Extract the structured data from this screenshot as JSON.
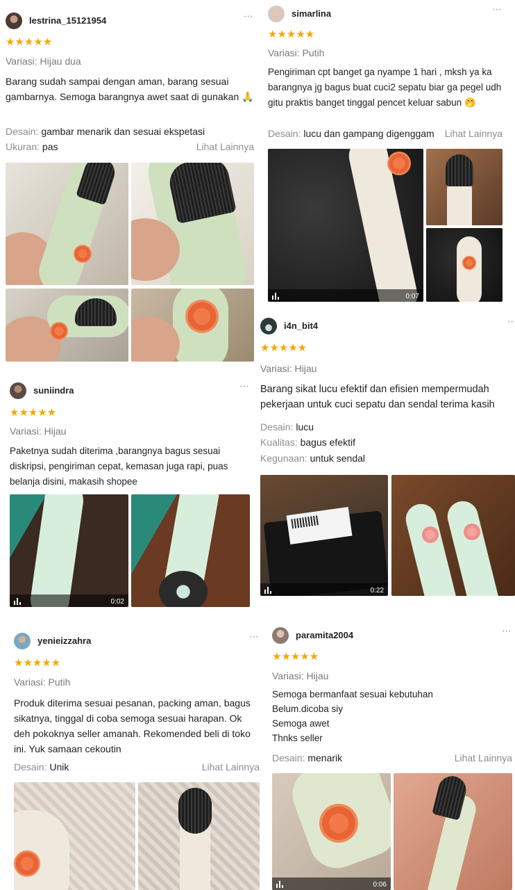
{
  "reviews": {
    "r1": {
      "username": "lestrina_15121954",
      "stars": "★★★★★",
      "variant": "Variasi: Hijau dua",
      "body": "Barang sudah sampai dengan aman, barang sesuai gambarnya. Semoga barangnya awet saat di gunakan 🙏",
      "attr1_key": "Desain:",
      "attr1_val": "gambar menarik dan sesuai ekspetasi",
      "attr2_key": "Ukuran:",
      "attr2_val": "pas",
      "see_more": "Lihat Lainnya"
    },
    "r2": {
      "username": "simarlina",
      "stars": "★★★★★",
      "variant": "Variasi: Putih",
      "body": "Pengiriman cpt banget ga nyampe 1 hari , mksh ya ka barangnya jg bagus buat cuci2 sepatu biar ga pegel udh gitu praktis banget tinggal pencet keluar sabun 🤭",
      "attr1_key": "Desain:",
      "attr1_val": "lucu dan gampang digenggam",
      "see_more": "Lihat Lainnya",
      "video_time": "0:07"
    },
    "r3": {
      "username": "i4n_bit4",
      "stars": "★★★★★",
      "variant": "Variasi: Hijau",
      "body": "Barang sikat lucu efektif dan efisien mempermudah pekerjaan untuk cuci sepatu dan sendal terima kasih",
      "attr1_key": "Desain:",
      "attr1_val": "lucu",
      "attr2_key": "Kualitas:",
      "attr2_val": "bagus efektif",
      "attr3_key": "Kegunaan:",
      "attr3_val": "untuk sendal",
      "video_time": "0:22"
    },
    "r4": {
      "username": "suniindra",
      "stars": "★★★★★",
      "variant": "Variasi: Hijau",
      "body": "Paketnya sudah diterima ,barangnya bagus sesuai diskripsi, pengiriman cepat, kemasan juga rapi, puas belanja disini, makasih shopee",
      "video_time": "0:02"
    },
    "r5": {
      "username": "yenieizzahra",
      "stars": "★★★★★",
      "variant": "Variasi: Putih",
      "body": "Produk diterima sesuai pesanan, packing aman, bagus sikatnya, tinggal di coba semoga sesuai harapan. Ok deh pokoknya seller amanah. Rekomended beli di toko ini. Yuk samaan cekoutin",
      "attr1_key": "Desain:",
      "attr1_val": "Unik",
      "see_more": "Lihat Lainnya"
    },
    "r6": {
      "username": "paramita2004",
      "stars": "★★★★★",
      "variant": "Variasi: Hijau",
      "line1": "Semoga bermanfaat sesuai kebutuhan",
      "line2": "Belum.dicoba siy",
      "line3": "Semoga awet",
      "line4": "Thnks seller",
      "attr1_key": "Desain:",
      "attr1_val": "menarik",
      "see_more": "Lihat Lainnya",
      "video_time": "0:06"
    }
  },
  "more_icon": "⋯",
  "colors": {
    "star": "#f6a700",
    "muted": "#8d8d8d",
    "text": "#222222"
  }
}
